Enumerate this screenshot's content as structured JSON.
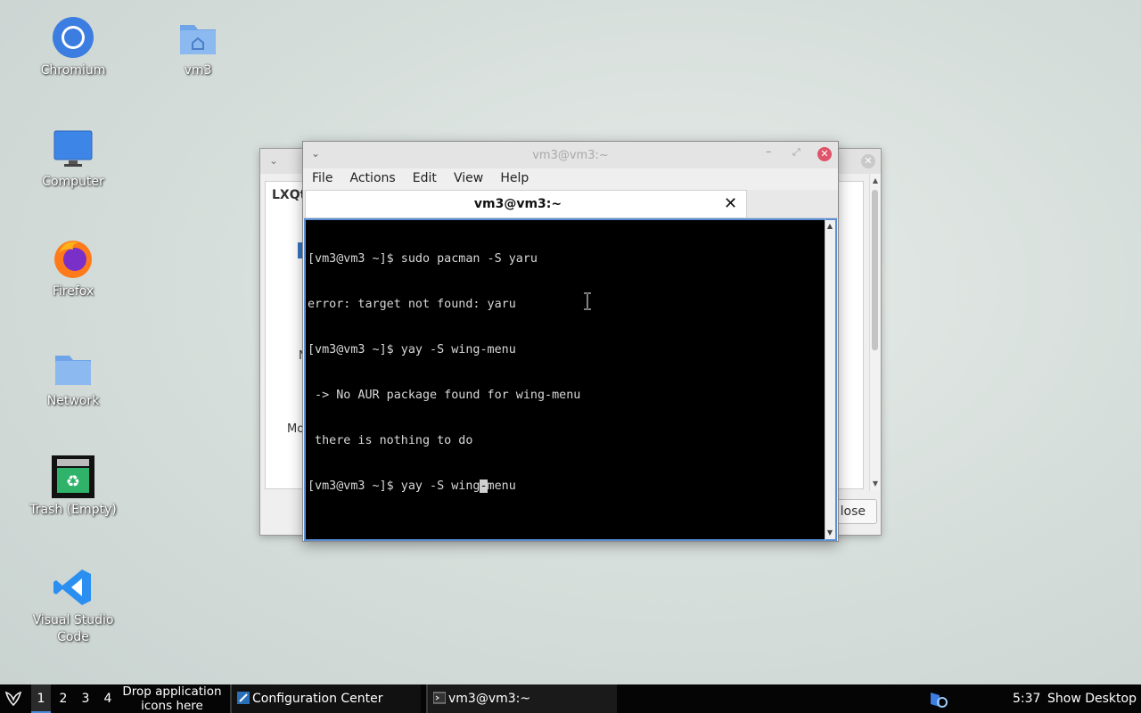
{
  "desktop": {
    "icons": [
      {
        "label": "Chromium",
        "icon": "chromium-icon"
      },
      {
        "label": "vm3",
        "icon": "home-folder-icon"
      },
      {
        "label": "Computer",
        "icon": "computer-icon"
      },
      {
        "label": "Firefox",
        "icon": "firefox-icon"
      },
      {
        "label": "Network",
        "icon": "network-folder-icon"
      },
      {
        "label": "Trash (Empty)",
        "icon": "trash-icon"
      },
      {
        "label": "Visual Studio Code",
        "icon": "vscode-icon"
      }
    ]
  },
  "back_window": {
    "heading": "LXQt",
    "frag1": "N",
    "frag2": "Mo",
    "close_label": "lose"
  },
  "terminal": {
    "title": "vm3@vm3:~",
    "menu": [
      "File",
      "Actions",
      "Edit",
      "View",
      "Help"
    ],
    "tab_label": "vm3@vm3:~",
    "lines": [
      "[vm3@vm3 ~]$ sudo pacman -S yaru",
      "error: target not found: yaru",
      "[vm3@vm3 ~]$ yay -S wing-menu",
      " -> No AUR package found for wing-menu",
      " there is nothing to do"
    ],
    "prompt_before_cursor": "[vm3@vm3 ~]$ yay -S wing",
    "cursor_char": "-",
    "prompt_after_cursor": "menu",
    "colors": {
      "background": "#000000",
      "text": "#d8d8d8",
      "focus_border": "#5a8fd6"
    }
  },
  "taskbar": {
    "desktops": [
      "1",
      "2",
      "3",
      "4"
    ],
    "active_desktop": "1",
    "drop_line1": "Drop application",
    "drop_line2": "icons here",
    "tasks": [
      {
        "label": "Configuration Center",
        "icon": "configuration-center-icon"
      },
      {
        "label": "vm3@vm3:~",
        "icon": "terminal-icon"
      }
    ],
    "clock": "5:37",
    "show_desktop": "Show Desktop"
  }
}
